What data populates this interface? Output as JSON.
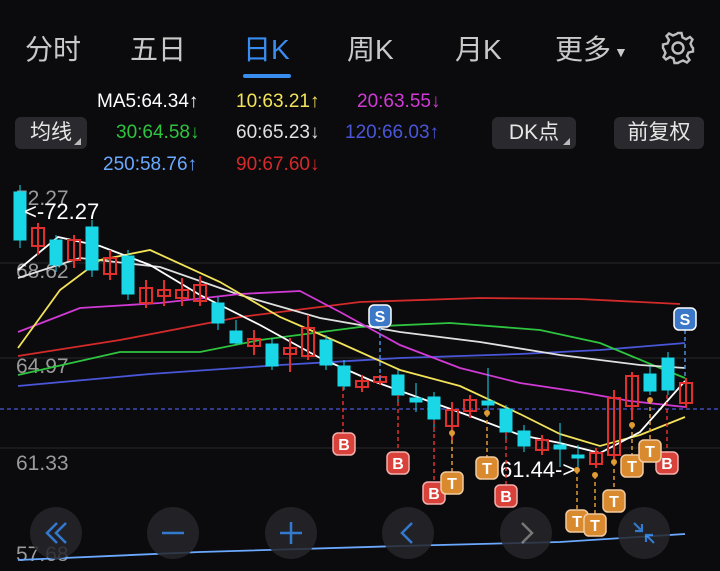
{
  "tabs": [
    {
      "label": "分时"
    },
    {
      "label": "五日"
    },
    {
      "label": "日K"
    },
    {
      "label": "周K"
    },
    {
      "label": "月K"
    },
    {
      "label": "更多"
    }
  ],
  "ma": {
    "ma5": "MA5:64.34",
    "ma10": "10:63.21",
    "ma20": "20:63.55",
    "ma30": "30:64.58",
    "ma60": "60:65.23",
    "ma120": "120:66.03",
    "ma250": "250:58.76",
    "ma90": "90:67.60",
    "arrow_up": "↑",
    "arrow_down": "↓"
  },
  "controls": {
    "indicator": "均线",
    "dk": "DK点",
    "adjust": "前复权"
  },
  "colors": {
    "active": "#3a8df0",
    "ma5": "#ffffff",
    "ma10": "#f3e35a",
    "ma20": "#d23ad6",
    "ma30": "#2ec43f",
    "ma60": "#e0e0e0",
    "ma120": "#4a56d8",
    "ma250": "#6aa9ff",
    "ma90": "#d42a2a",
    "up": "#e0302e",
    "down": "#19d7e6"
  },
  "chart_data": {
    "type": "candlestick",
    "price_labels": [
      "72.27",
      "68.62",
      "64.97",
      "61.33",
      "57.68"
    ],
    "high_annotation": "<-72.27",
    "low_annotation": "61.44->",
    "signals": {
      "buy": "B",
      "sell": "S",
      "t": "T"
    }
  }
}
